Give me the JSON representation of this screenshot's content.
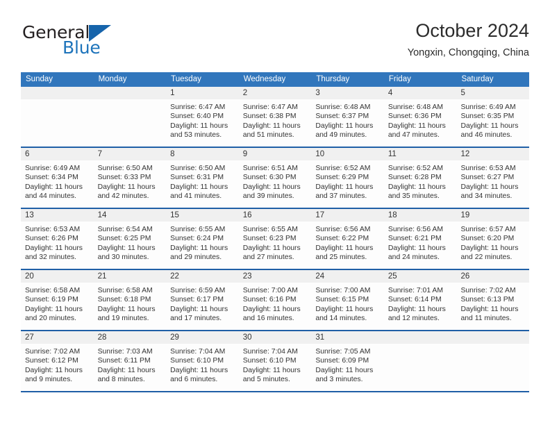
{
  "logo": {
    "word_one": "General",
    "word_two": "Blue",
    "triangle_icon": "blue-triangle-icon",
    "accent_color": "#1664ab"
  },
  "header": {
    "title": "October 2024",
    "subtitle": "Yongxin, Chongqing, China"
  },
  "theme": {
    "header_blue": "#3176bc",
    "row_divider_blue": "#1f5fa6",
    "daynum_strip": "#f0f0f0",
    "text": "#333333"
  },
  "weekdays": [
    "Sunday",
    "Monday",
    "Tuesday",
    "Wednesday",
    "Thursday",
    "Friday",
    "Saturday"
  ],
  "weeks": [
    [
      {
        "day": "",
        "sunrise": "",
        "sunset": "",
        "daylight": "",
        "empty": true
      },
      {
        "day": "",
        "sunrise": "",
        "sunset": "",
        "daylight": "",
        "empty": true
      },
      {
        "day": "1",
        "sunrise": "Sunrise: 6:47 AM",
        "sunset": "Sunset: 6:40 PM",
        "daylight": "Daylight: 11 hours and 53 minutes."
      },
      {
        "day": "2",
        "sunrise": "Sunrise: 6:47 AM",
        "sunset": "Sunset: 6:38 PM",
        "daylight": "Daylight: 11 hours and 51 minutes."
      },
      {
        "day": "3",
        "sunrise": "Sunrise: 6:48 AM",
        "sunset": "Sunset: 6:37 PM",
        "daylight": "Daylight: 11 hours and 49 minutes."
      },
      {
        "day": "4",
        "sunrise": "Sunrise: 6:48 AM",
        "sunset": "Sunset: 6:36 PM",
        "daylight": "Daylight: 11 hours and 47 minutes."
      },
      {
        "day": "5",
        "sunrise": "Sunrise: 6:49 AM",
        "sunset": "Sunset: 6:35 PM",
        "daylight": "Daylight: 11 hours and 46 minutes."
      }
    ],
    [
      {
        "day": "6",
        "sunrise": "Sunrise: 6:49 AM",
        "sunset": "Sunset: 6:34 PM",
        "daylight": "Daylight: 11 hours and 44 minutes."
      },
      {
        "day": "7",
        "sunrise": "Sunrise: 6:50 AM",
        "sunset": "Sunset: 6:33 PM",
        "daylight": "Daylight: 11 hours and 42 minutes."
      },
      {
        "day": "8",
        "sunrise": "Sunrise: 6:50 AM",
        "sunset": "Sunset: 6:31 PM",
        "daylight": "Daylight: 11 hours and 41 minutes."
      },
      {
        "day": "9",
        "sunrise": "Sunrise: 6:51 AM",
        "sunset": "Sunset: 6:30 PM",
        "daylight": "Daylight: 11 hours and 39 minutes."
      },
      {
        "day": "10",
        "sunrise": "Sunrise: 6:52 AM",
        "sunset": "Sunset: 6:29 PM",
        "daylight": "Daylight: 11 hours and 37 minutes."
      },
      {
        "day": "11",
        "sunrise": "Sunrise: 6:52 AM",
        "sunset": "Sunset: 6:28 PM",
        "daylight": "Daylight: 11 hours and 35 minutes."
      },
      {
        "day": "12",
        "sunrise": "Sunrise: 6:53 AM",
        "sunset": "Sunset: 6:27 PM",
        "daylight": "Daylight: 11 hours and 34 minutes."
      }
    ],
    [
      {
        "day": "13",
        "sunrise": "Sunrise: 6:53 AM",
        "sunset": "Sunset: 6:26 PM",
        "daylight": "Daylight: 11 hours and 32 minutes."
      },
      {
        "day": "14",
        "sunrise": "Sunrise: 6:54 AM",
        "sunset": "Sunset: 6:25 PM",
        "daylight": "Daylight: 11 hours and 30 minutes."
      },
      {
        "day": "15",
        "sunrise": "Sunrise: 6:55 AM",
        "sunset": "Sunset: 6:24 PM",
        "daylight": "Daylight: 11 hours and 29 minutes."
      },
      {
        "day": "16",
        "sunrise": "Sunrise: 6:55 AM",
        "sunset": "Sunset: 6:23 PM",
        "daylight": "Daylight: 11 hours and 27 minutes."
      },
      {
        "day": "17",
        "sunrise": "Sunrise: 6:56 AM",
        "sunset": "Sunset: 6:22 PM",
        "daylight": "Daylight: 11 hours and 25 minutes."
      },
      {
        "day": "18",
        "sunrise": "Sunrise: 6:56 AM",
        "sunset": "Sunset: 6:21 PM",
        "daylight": "Daylight: 11 hours and 24 minutes."
      },
      {
        "day": "19",
        "sunrise": "Sunrise: 6:57 AM",
        "sunset": "Sunset: 6:20 PM",
        "daylight": "Daylight: 11 hours and 22 minutes."
      }
    ],
    [
      {
        "day": "20",
        "sunrise": "Sunrise: 6:58 AM",
        "sunset": "Sunset: 6:19 PM",
        "daylight": "Daylight: 11 hours and 20 minutes."
      },
      {
        "day": "21",
        "sunrise": "Sunrise: 6:58 AM",
        "sunset": "Sunset: 6:18 PM",
        "daylight": "Daylight: 11 hours and 19 minutes."
      },
      {
        "day": "22",
        "sunrise": "Sunrise: 6:59 AM",
        "sunset": "Sunset: 6:17 PM",
        "daylight": "Daylight: 11 hours and 17 minutes."
      },
      {
        "day": "23",
        "sunrise": "Sunrise: 7:00 AM",
        "sunset": "Sunset: 6:16 PM",
        "daylight": "Daylight: 11 hours and 16 minutes."
      },
      {
        "day": "24",
        "sunrise": "Sunrise: 7:00 AM",
        "sunset": "Sunset: 6:15 PM",
        "daylight": "Daylight: 11 hours and 14 minutes."
      },
      {
        "day": "25",
        "sunrise": "Sunrise: 7:01 AM",
        "sunset": "Sunset: 6:14 PM",
        "daylight": "Daylight: 11 hours and 12 minutes."
      },
      {
        "day": "26",
        "sunrise": "Sunrise: 7:02 AM",
        "sunset": "Sunset: 6:13 PM",
        "daylight": "Daylight: 11 hours and 11 minutes."
      }
    ],
    [
      {
        "day": "27",
        "sunrise": "Sunrise: 7:02 AM",
        "sunset": "Sunset: 6:12 PM",
        "daylight": "Daylight: 11 hours and 9 minutes."
      },
      {
        "day": "28",
        "sunrise": "Sunrise: 7:03 AM",
        "sunset": "Sunset: 6:11 PM",
        "daylight": "Daylight: 11 hours and 8 minutes."
      },
      {
        "day": "29",
        "sunrise": "Sunrise: 7:04 AM",
        "sunset": "Sunset: 6:10 PM",
        "daylight": "Daylight: 11 hours and 6 minutes."
      },
      {
        "day": "30",
        "sunrise": "Sunrise: 7:04 AM",
        "sunset": "Sunset: 6:10 PM",
        "daylight": "Daylight: 11 hours and 5 minutes."
      },
      {
        "day": "31",
        "sunrise": "Sunrise: 7:05 AM",
        "sunset": "Sunset: 6:09 PM",
        "daylight": "Daylight: 11 hours and 3 minutes."
      },
      {
        "day": "",
        "sunrise": "",
        "sunset": "",
        "daylight": "",
        "empty": true
      },
      {
        "day": "",
        "sunrise": "",
        "sunset": "",
        "daylight": "",
        "empty": true
      }
    ]
  ]
}
